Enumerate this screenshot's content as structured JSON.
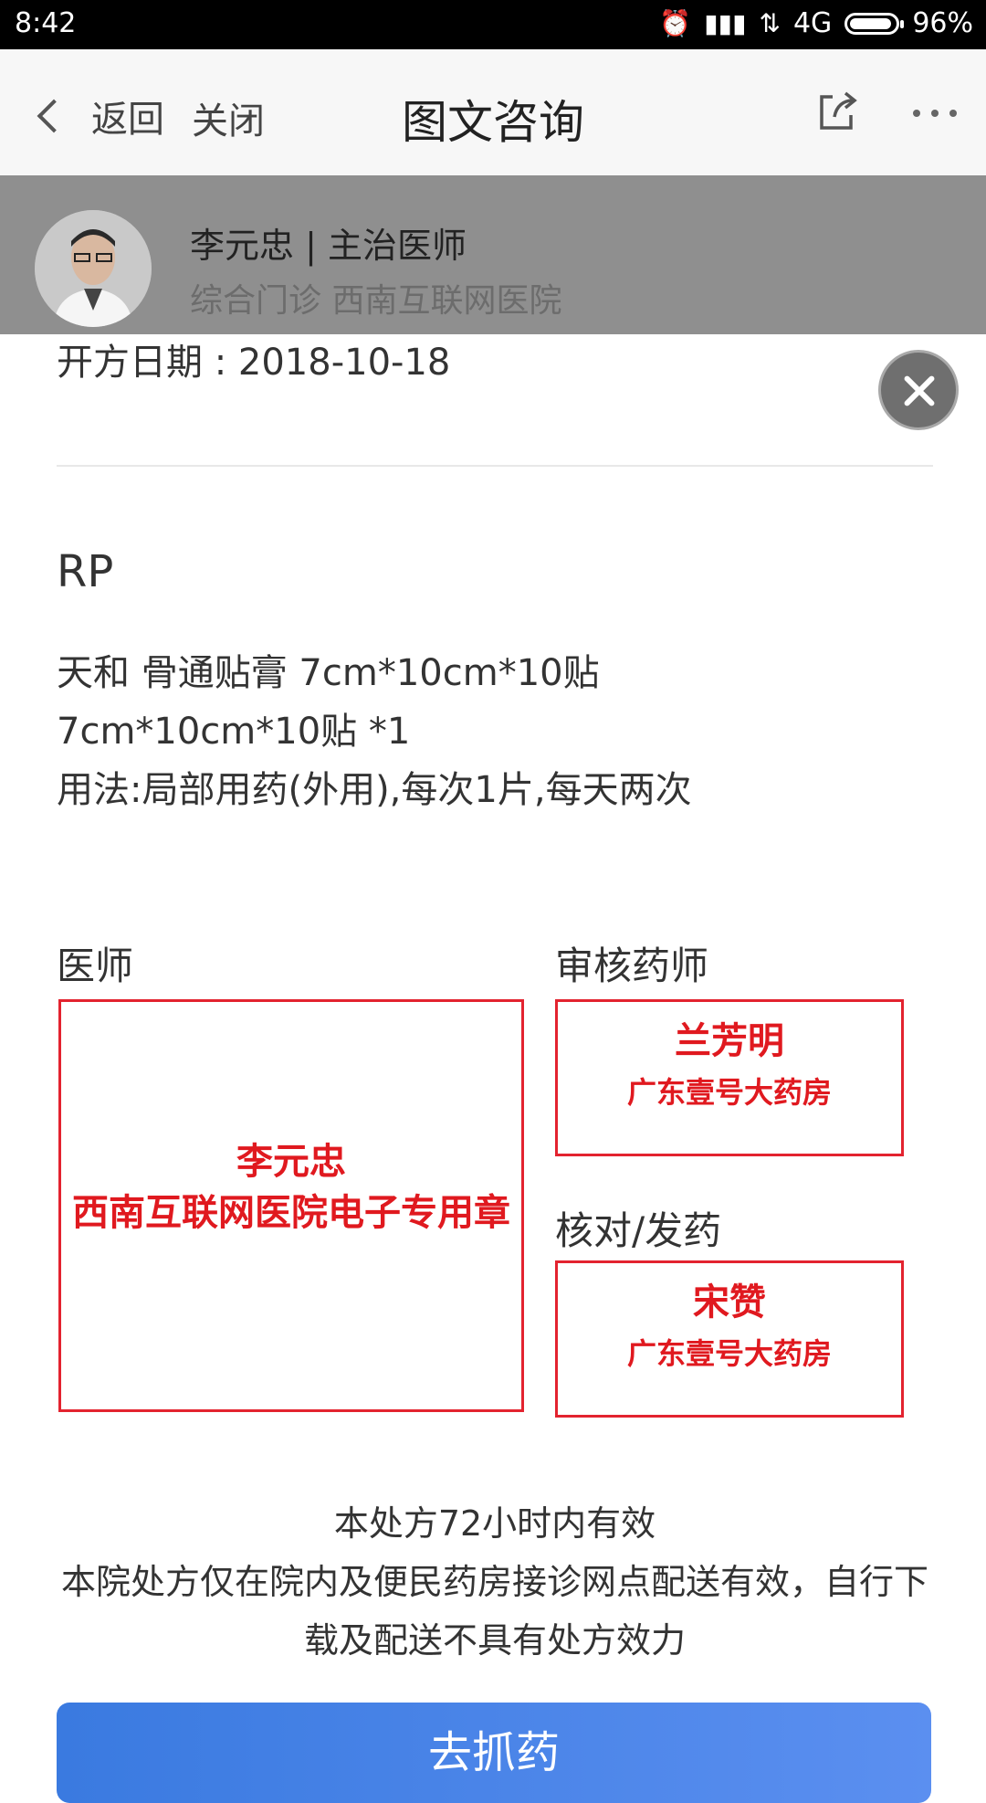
{
  "status_bar": {
    "time": "8:42",
    "network": "4G",
    "battery_percent": "96%"
  },
  "nav": {
    "back_label": "返回",
    "close_label": "关闭",
    "title": "图文咨询",
    "icons": [
      "chevron-left-icon",
      "share-icon",
      "more-icon"
    ]
  },
  "doctor": {
    "name_title": "李元忠 | 主治医师",
    "department_hospital": "综合门诊 西南互联网医院"
  },
  "prescription": {
    "date_line": "开方日期 : 2018-10-18",
    "rp_label": "RP",
    "medicine_lines": [
      "天和 骨通贴膏 7cm*10cm*10贴",
      "7cm*10cm*10贴 *1",
      "用法:局部用药(外用),每次1片,每天两次"
    ]
  },
  "signatures": {
    "doctor_label": "医师",
    "doctor_stamp": [
      "李元忠",
      "西南互联网医院电子专用章"
    ],
    "pharmacist_label": "审核药师",
    "pharmacist_stamp": [
      "兰芳明",
      "广东壹号大药房"
    ],
    "dispense_label": "核对/发药",
    "dispense_stamp": [
      "宋赞",
      "广东壹号大药房"
    ]
  },
  "notice": {
    "line1": "本处方72小时内有效",
    "line2": "本院处方仅在院内及便民药房接诊网点配送有效，自行下载及配送不具有处方效力"
  },
  "action": {
    "button_label": "去抓药"
  },
  "colors": {
    "stamp_red": "#e0191f",
    "primary_blue": "#3a7ae0",
    "header_gray": "#8f8f8f"
  }
}
